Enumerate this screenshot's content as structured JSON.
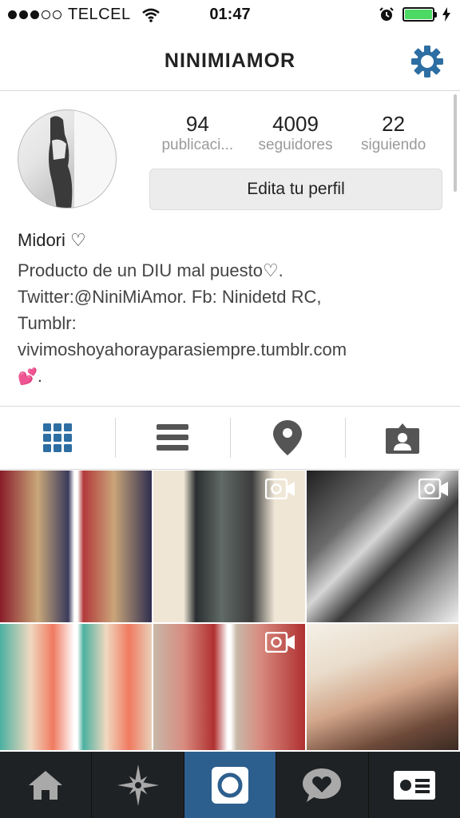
{
  "status_bar": {
    "carrier": "TELCEL",
    "time": "01:47",
    "battery_color": "#4cd964"
  },
  "header": {
    "title": "NINIMIAMOR",
    "settings_icon": "gear-icon",
    "accent_color": "#2d6ea3"
  },
  "profile": {
    "stats": [
      {
        "value": "94",
        "label": "publicaci..."
      },
      {
        "value": "4009",
        "label": "seguidores"
      },
      {
        "value": "22",
        "label": "siguiendo"
      }
    ],
    "edit_label": "Edita tu perfil",
    "name": "Midori ♡",
    "bio_lines": [
      "Producto de un DIU mal puesto♡.",
      "Twitter:@NiniMiAmor. Fb: Ninidetd RC,",
      "Tumblr:",
      "vivimoshoyahorayparasiempre.tumblr.com",
      "."
    ],
    "bio_emoji": "💕"
  },
  "tabs": [
    {
      "icon": "grid-icon",
      "active": true
    },
    {
      "icon": "list-icon",
      "active": false
    },
    {
      "icon": "location-pin-icon",
      "active": false
    },
    {
      "icon": "tagged-person-icon",
      "active": false
    }
  ],
  "grid": {
    "photos": [
      {
        "video": false
      },
      {
        "video": true
      },
      {
        "video": true
      },
      {
        "video": false
      },
      {
        "video": true
      },
      {
        "video": false
      }
    ]
  },
  "bottom_nav": [
    {
      "icon": "home-icon",
      "active": false
    },
    {
      "icon": "explore-star-icon",
      "active": false
    },
    {
      "icon": "camera-icon",
      "active": true
    },
    {
      "icon": "activity-heart-icon",
      "active": false
    },
    {
      "icon": "profile-card-icon",
      "active": false
    }
  ]
}
